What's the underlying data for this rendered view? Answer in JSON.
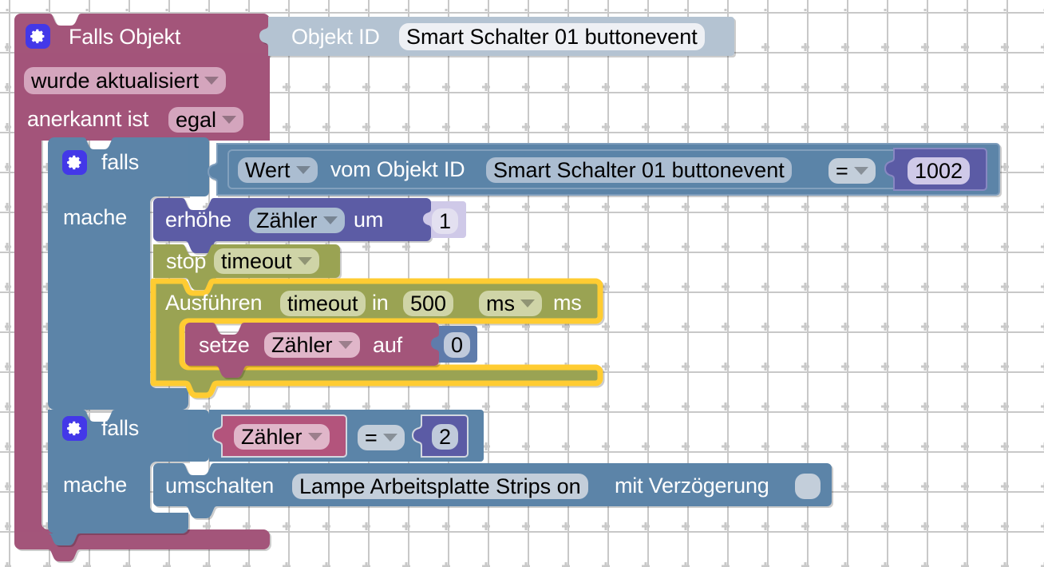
{
  "app": {
    "title": "Blockly Script Editor",
    "canvas_background": "#ffffff",
    "grid_color": "#c8c8c8",
    "grid_spacing_px": 50
  },
  "palette": {
    "trigger_block": "#a3547a",
    "trigger_field": "#d4a5bd",
    "control_block": "#5b84a8",
    "control_field": "#abbdd1",
    "math_block": "#5b5ba5",
    "math_field": "#cfc9e8",
    "timer_block": "#9aa352",
    "timer_field": "#cfd4a7",
    "variable_block": "#a3547a",
    "variable_field": "#e0b6c9",
    "logic_field": "#c3ceda",
    "selected_outline": "#ffcc33",
    "gear_icon_bg": "#4338e8",
    "text_light": "#ffffff",
    "text_dark": "#000000"
  },
  "blocks": {
    "trigger": {
      "name": "on-object-change-trigger",
      "icon": "gear-icon",
      "label": "Falls Objekt",
      "object_id_label": "Objekt ID",
      "object_id_value": "Smart Schalter 01 buttonevent",
      "change_mode": "wurde aktualisiert",
      "ack_label": "anerkannt ist",
      "ack_value": "egal"
    },
    "if_value": {
      "name": "if-value-block",
      "icon": "gear-icon",
      "if_label": "falls",
      "do_label": "mache",
      "condition": {
        "source_select": "Wert",
        "from_label": "vom Objekt ID",
        "object_id": "Smart Schalter 01 buttonevent",
        "operator": "=",
        "compare_value": "1002"
      }
    },
    "increment": {
      "name": "increment-variable-block",
      "verb": "erhöhe",
      "variable": "Zähler",
      "by_label": "um",
      "amount": "1"
    },
    "stop_timeout": {
      "name": "stop-timeout-block",
      "verb": "stop",
      "timer_name": "timeout"
    },
    "run_timeout": {
      "name": "run-timeout-block",
      "selected": true,
      "verb": "Ausführen",
      "timer_name": "timeout",
      "in_label": "in",
      "delay_value": "500",
      "unit_select": "ms",
      "unit_suffix": "ms"
    },
    "set_variable": {
      "name": "set-variable-block",
      "verb": "setze",
      "variable": "Zähler",
      "to_label": "auf",
      "value": "0"
    },
    "if_counter": {
      "name": "if-counter-block",
      "icon": "gear-icon",
      "if_label": "falls",
      "do_label": "mache",
      "condition": {
        "variable": "Zähler",
        "operator": "=",
        "compare_value": "2"
      }
    },
    "toggle": {
      "name": "toggle-object-block",
      "verb": "umschalten",
      "object_id": "Lampe Arbeitsplatte Strips on",
      "delay_label": "mit Verzögerung",
      "delay_value": ""
    }
  }
}
